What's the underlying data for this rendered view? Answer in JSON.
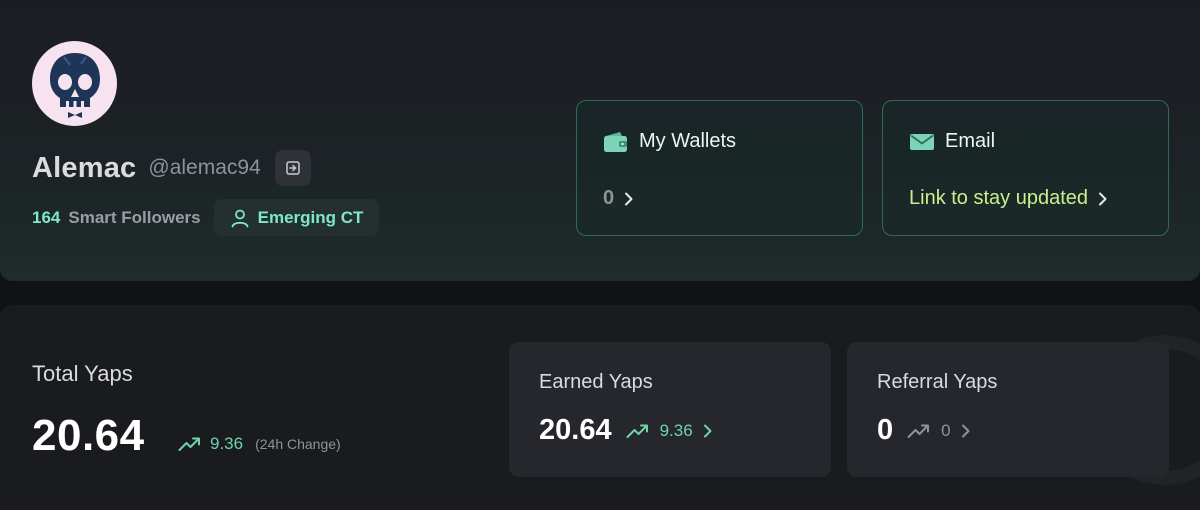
{
  "profile": {
    "display_name": "Alemac",
    "handle": "@alemac94",
    "smart_followers_count": "164",
    "smart_followers_label": "Smart Followers",
    "tier": "Emerging CT",
    "avatar_icon": "skull-avatar-icon"
  },
  "wallets": {
    "title": "My Wallets",
    "count": "0",
    "icon": "wallet-icon"
  },
  "email": {
    "title": "Email",
    "link_text": "Link to stay updated",
    "icon": "envelope-icon"
  },
  "total_yaps": {
    "label": "Total Yaps",
    "value": "20.64",
    "change": "9.36",
    "change_note": "(24h Change)"
  },
  "earned_yaps": {
    "label": "Earned Yaps",
    "value": "20.64",
    "change": "9.36"
  },
  "referral_yaps": {
    "label": "Referral Yaps",
    "value": "0",
    "change": "0"
  },
  "colors": {
    "accent": "#7ee8c5",
    "email_link": "#c9f08e",
    "positive_change": "#6fd3a8",
    "card_border": "#2f6a58"
  }
}
